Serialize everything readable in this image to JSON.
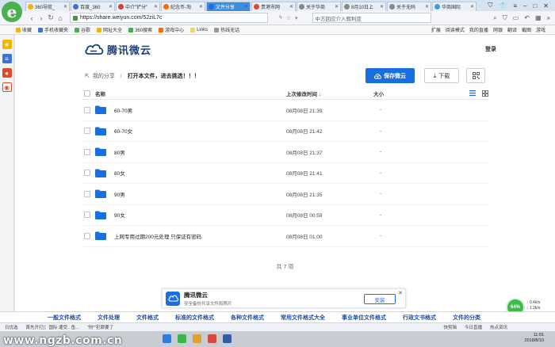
{
  "tabs": [
    {
      "label": "360导航_",
      "color": "#f2b600",
      "active": false
    },
    {
      "label": "百度_360",
      "color": "#3b73d6",
      "active": false
    },
    {
      "label": "中介\"铲分\"",
      "color": "#d63b3b",
      "active": false
    },
    {
      "label": "纪念币-淘",
      "color": "#ff6a00",
      "active": false
    },
    {
      "label": "文件分享",
      "color": "#1a6fe0",
      "active": true
    },
    {
      "label": "贵港市网",
      "color": "#e04a2a",
      "active": false
    },
    {
      "label": "关于华商",
      "color": "#888888",
      "active": false
    },
    {
      "label": "8月10日上",
      "color": "#888888",
      "active": false
    },
    {
      "label": "关于无码",
      "color": "#888888",
      "active": false
    },
    {
      "label": "华商国际",
      "color": "#3da0d6",
      "active": false
    }
  ],
  "address": {
    "url": "https://share.weiyun.com/52ziL7c",
    "search": "中方回应介入叙利亚"
  },
  "bookmarks": {
    "left": [
      {
        "label": "收藏",
        "color": "#f2b600"
      },
      {
        "label": "手机收藏夹",
        "color": "#3b73d6"
      },
      {
        "label": "谷歌",
        "color": "#4caf50"
      },
      {
        "label": "网址大全",
        "color": "#f2b600"
      },
      {
        "label": "360搜索",
        "color": "#3bb54a"
      },
      {
        "label": "游戏中心",
        "color": "#ff6a00"
      },
      {
        "label": "Links",
        "color": "#f2d46b"
      },
      {
        "label": "热线无话",
        "color": "#999999"
      }
    ],
    "right": [
      "扩展",
      "阅读模式",
      "我的直播",
      "网银",
      "翻译",
      "截图",
      "游戏"
    ]
  },
  "page": {
    "brand": "腾讯微云",
    "login": "登录",
    "breadcrumb": {
      "home": "我的分享",
      "current": "打开本文件，进去挑选！！！"
    },
    "save_label": "保存微云",
    "download_label": "下载",
    "columns": {
      "name": "名称",
      "time": "上次修改时间 ↓",
      "size": "大小"
    },
    "files": [
      {
        "name": "60-70男",
        "time": "08月08日 21:39",
        "size": "-"
      },
      {
        "name": "60-70女",
        "time": "08月08日 21:42",
        "size": "-"
      },
      {
        "name": "80男",
        "time": "08月08日 21:37",
        "size": "-"
      },
      {
        "name": "80女",
        "time": "08月08日 21:41",
        "size": "-"
      },
      {
        "name": "90男",
        "time": "08月08日 21:35",
        "size": "-"
      },
      {
        "name": "90女",
        "time": "08月08日 00:59",
        "size": "-"
      },
      {
        "name": "上网专用过期200元处理 只保证有密码",
        "time": "08月08日 01:00",
        "size": "-"
      }
    ],
    "total": "共 7 项"
  },
  "promo": {
    "title": "腾讯微云",
    "subtitle": "安全备份共享文件和照片",
    "install_label": "安装"
  },
  "tags": [
    "一般文件格式",
    "文件处理",
    "文件格式",
    "标准的文件格式",
    "各种文件格式",
    "常用文件格式大全",
    "事业单位文件格式",
    "行政文书格式",
    "文件的分类"
  ],
  "status": {
    "left": [
      "日优选",
      "首先开打]：国际 遭受...鱼...",
      "\"刑\"\"犯罪要了"
    ],
    "right": [
      "快剪辑",
      "今日直播",
      "热点资讯"
    ]
  },
  "speed": {
    "percent": "64%",
    "up": "0.4k/s",
    "down": "1.2k/s"
  },
  "clock": {
    "time": "11:01",
    "date": "2018/8/10"
  },
  "watermark": "www.ngzb.com.cn",
  "colors": {
    "accent": "#1a6fe0",
    "brand_text": "#1c3f77",
    "folder": "#1a6fe0"
  }
}
